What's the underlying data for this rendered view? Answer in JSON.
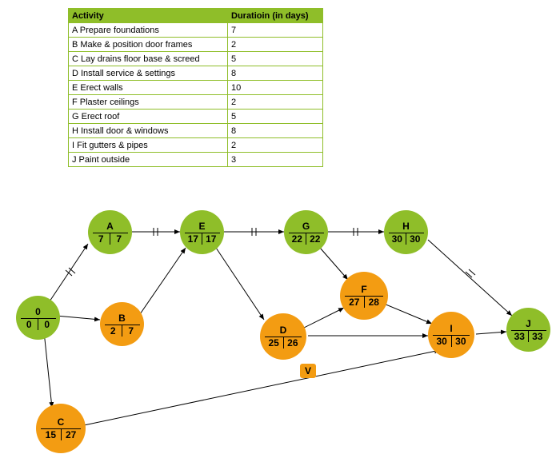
{
  "table": {
    "headers": [
      "Activity",
      "Duratioin (in days)"
    ],
    "rows": [
      [
        "A Prepare foundations",
        "7"
      ],
      [
        "B Make & position door frames",
        "2"
      ],
      [
        "C Lay drains floor base & screed",
        "5"
      ],
      [
        "D Install service & settings",
        "8"
      ],
      [
        "E Erect walls",
        "10"
      ],
      [
        "F Plaster ceilings",
        "2"
      ],
      [
        "G Erect roof",
        "5"
      ],
      [
        "H Install door & windows",
        "8"
      ],
      [
        "I Fit gutters & pipes",
        "2"
      ],
      [
        "J Paint outside",
        "3"
      ]
    ]
  },
  "nodes": {
    "start": {
      "label": "0",
      "l": "0",
      "r": "0"
    },
    "A": {
      "label": "A",
      "l": "7",
      "r": "7"
    },
    "B": {
      "label": "B",
      "l": "2",
      "r": "7"
    },
    "C": {
      "label": "C",
      "l": "15",
      "r": "27"
    },
    "D": {
      "label": "D",
      "l": "25",
      "r": "26"
    },
    "E": {
      "label": "E",
      "l": "17",
      "r": "17"
    },
    "F": {
      "label": "F",
      "l": "27",
      "r": "28"
    },
    "G": {
      "label": "G",
      "l": "22",
      "r": "22"
    },
    "H": {
      "label": "H",
      "l": "30",
      "r": "30"
    },
    "I": {
      "label": "I",
      "l": "30",
      "r": "30"
    },
    "J": {
      "label": "J",
      "l": "33",
      "r": "33"
    },
    "V": {
      "label": "V"
    }
  },
  "chart_data": {
    "type": "activity-on-node-network",
    "table": [
      {
        "activity": "A",
        "desc": "Prepare foundations",
        "duration": 7
      },
      {
        "activity": "B",
        "desc": "Make & position door frames",
        "duration": 2
      },
      {
        "activity": "C",
        "desc": "Lay drains floor base & screed",
        "duration": 5
      },
      {
        "activity": "D",
        "desc": "Install service & settings",
        "duration": 8
      },
      {
        "activity": "E",
        "desc": "Erect walls",
        "duration": 10
      },
      {
        "activity": "F",
        "desc": "Plaster ceilings",
        "duration": 2
      },
      {
        "activity": "G",
        "desc": "Erect roof",
        "duration": 5
      },
      {
        "activity": "H",
        "desc": "Install door & windows",
        "duration": 8
      },
      {
        "activity": "I",
        "desc": "Fit gutters & pipes",
        "duration": 2
      },
      {
        "activity": "J",
        "desc": "Paint outside",
        "duration": 3
      }
    ],
    "nodes": [
      {
        "id": "0",
        "earliest": 0,
        "latest": 0,
        "critical": true
      },
      {
        "id": "A",
        "earliest": 7,
        "latest": 7,
        "critical": true
      },
      {
        "id": "B",
        "earliest": 2,
        "latest": 7,
        "critical": false
      },
      {
        "id": "C",
        "earliest": 15,
        "latest": 27,
        "critical": false
      },
      {
        "id": "D",
        "earliest": 25,
        "latest": 26,
        "critical": false
      },
      {
        "id": "E",
        "earliest": 17,
        "latest": 17,
        "critical": true
      },
      {
        "id": "F",
        "earliest": 27,
        "latest": 28,
        "critical": false
      },
      {
        "id": "G",
        "earliest": 22,
        "latest": 22,
        "critical": true
      },
      {
        "id": "H",
        "earliest": 30,
        "latest": 30,
        "critical": true
      },
      {
        "id": "I",
        "earliest": 30,
        "latest": 30,
        "critical": false
      },
      {
        "id": "J",
        "earliest": 33,
        "latest": 33,
        "critical": true
      }
    ],
    "edges": [
      [
        "0",
        "A"
      ],
      [
        "0",
        "B"
      ],
      [
        "0",
        "C"
      ],
      [
        "A",
        "E"
      ],
      [
        "B",
        "E"
      ],
      [
        "E",
        "G"
      ],
      [
        "E",
        "D"
      ],
      [
        "G",
        "H"
      ],
      [
        "G",
        "F"
      ],
      [
        "D",
        "F"
      ],
      [
        "D",
        "I"
      ],
      [
        "F",
        "I"
      ],
      [
        "H",
        "J"
      ],
      [
        "I",
        "J"
      ],
      [
        "C",
        "I"
      ]
    ]
  }
}
